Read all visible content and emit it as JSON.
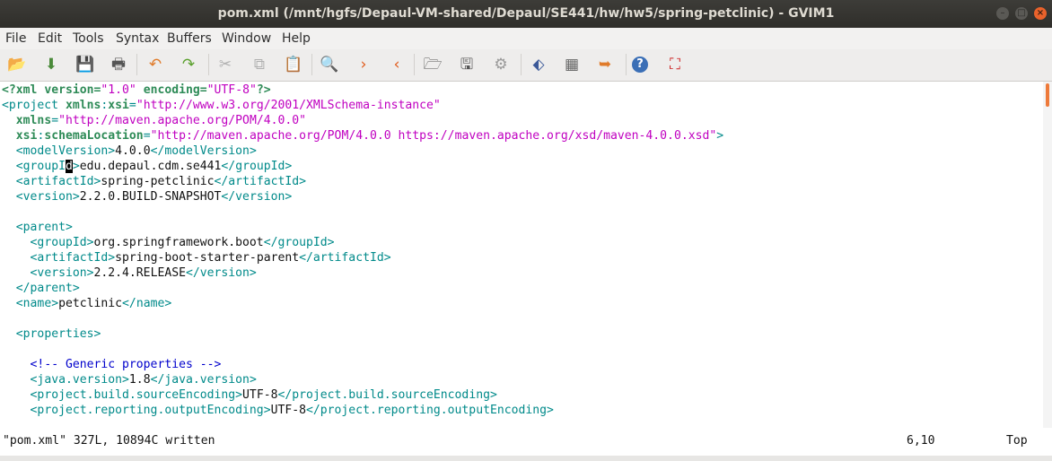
{
  "window": {
    "title": "pom.xml (/mnt/hgfs/Depaul-VM-shared/Depaul/SE441/hw/hw5/spring-petclinic) - GVIM1",
    "buttons": {
      "minimize": "–",
      "maximize": "□",
      "close": "×"
    }
  },
  "menu": [
    "File",
    "Edit",
    "Tools",
    "Syntax",
    "Buffers",
    "Window",
    "Help"
  ],
  "toolbar": [
    {
      "name": "open-icon",
      "glyph": "📂",
      "color": "#e07b2a"
    },
    {
      "name": "save-download-icon",
      "glyph": "⬇",
      "color": "#4a8a3a"
    },
    {
      "name": "save-icon",
      "glyph": "💾",
      "color": "#3b5998"
    },
    {
      "name": "print-icon",
      "glyph": "🖶",
      "color": "#555555"
    },
    {
      "name": "undo-icon",
      "glyph": "↶",
      "color": "#e07b2a"
    },
    {
      "name": "redo-icon",
      "glyph": "↷",
      "color": "#5aa02c"
    },
    {
      "name": "cut-icon",
      "glyph": "✂",
      "color": "#b0b0b0"
    },
    {
      "name": "copy-icon",
      "glyph": "⧉",
      "color": "#b0b0b0"
    },
    {
      "name": "paste-icon",
      "glyph": "📋",
      "color": "#7a6a4a"
    },
    {
      "name": "find-replace-icon",
      "glyph": "🔍",
      "color": "#3b5998"
    },
    {
      "name": "find-next-icon",
      "glyph": "›",
      "color": "#e05a1a"
    },
    {
      "name": "find-prev-icon",
      "glyph": "‹",
      "color": "#e05a1a"
    },
    {
      "name": "load-session-icon",
      "glyph": "🗁",
      "color": "#555555"
    },
    {
      "name": "save-session-icon",
      "glyph": "🖫",
      "color": "#555555"
    },
    {
      "name": "run-script-icon",
      "glyph": "⚙",
      "color": "#999999"
    },
    {
      "name": "make-icon",
      "glyph": "⬖",
      "color": "#3b5998"
    },
    {
      "name": "build-tags-icon",
      "glyph": "▦",
      "color": "#666666"
    },
    {
      "name": "jump-tag-icon",
      "glyph": "➥",
      "color": "#e07b2a"
    },
    {
      "name": "help-icon",
      "glyph": "?",
      "color": "#ffffff"
    },
    {
      "name": "find-help-icon",
      "glyph": "⛶",
      "color": "#cc2222"
    }
  ],
  "editor": {
    "lines": [
      [
        [
          "pi",
          "<?xml "
        ],
        [
          "pi",
          "version"
        ],
        [
          "pi",
          "="
        ],
        [
          "val",
          "\"1.0\""
        ],
        [
          "pi",
          " encoding"
        ],
        [
          "pi",
          "="
        ],
        [
          "val",
          "\"UTF-8\""
        ],
        [
          "pi",
          "?>"
        ]
      ],
      [
        [
          "tag",
          "<project "
        ],
        [
          "attr",
          "xmlns"
        ],
        [
          "tag",
          ":"
        ],
        [
          "attr",
          "xsi"
        ],
        [
          "tag",
          "="
        ],
        [
          "val",
          "\"http://www.w3.org/2001/XMLSchema-instance\""
        ]
      ],
      [
        [
          "plain",
          "  "
        ],
        [
          "attr",
          "xmlns"
        ],
        [
          "tag",
          "="
        ],
        [
          "val",
          "\"http://maven.apache.org/POM/4.0.0\""
        ]
      ],
      [
        [
          "plain",
          "  "
        ],
        [
          "attr",
          "xsi"
        ],
        [
          "tag",
          ":"
        ],
        [
          "attr",
          "schemaLocation"
        ],
        [
          "tag",
          "="
        ],
        [
          "val",
          "\"http://maven.apache.org/POM/4.0.0 https://maven.apache.org/xsd/maven-4.0.0.xsd\""
        ],
        [
          "tag",
          ">"
        ]
      ],
      [
        [
          "plain",
          "  "
        ],
        [
          "tag",
          "<modelVersion>"
        ],
        [
          "plain",
          "4.0.0"
        ],
        [
          "tag",
          "</modelVersion>"
        ]
      ],
      [
        [
          "plain",
          "  "
        ],
        [
          "tag",
          "<groupI"
        ],
        [
          "cursor",
          "d"
        ],
        [
          "tag",
          ">"
        ],
        [
          "plain",
          "edu.depaul.cdm.se441"
        ],
        [
          "tag",
          "</groupId>"
        ]
      ],
      [
        [
          "plain",
          "  "
        ],
        [
          "tag",
          "<artifactId>"
        ],
        [
          "plain",
          "spring-petclinic"
        ],
        [
          "tag",
          "</artifactId>"
        ]
      ],
      [
        [
          "plain",
          "  "
        ],
        [
          "tag",
          "<version>"
        ],
        [
          "plain",
          "2.2.0.BUILD-SNAPSHOT"
        ],
        [
          "tag",
          "</version>"
        ]
      ],
      [],
      [
        [
          "plain",
          "  "
        ],
        [
          "tag",
          "<parent>"
        ]
      ],
      [
        [
          "plain",
          "    "
        ],
        [
          "tag",
          "<groupId>"
        ],
        [
          "plain",
          "org.springframework.boot"
        ],
        [
          "tag",
          "</groupId>"
        ]
      ],
      [
        [
          "plain",
          "    "
        ],
        [
          "tag",
          "<artifactId>"
        ],
        [
          "plain",
          "spring-boot-starter-parent"
        ],
        [
          "tag",
          "</artifactId>"
        ]
      ],
      [
        [
          "plain",
          "    "
        ],
        [
          "tag",
          "<version>"
        ],
        [
          "plain",
          "2.2.4.RELEASE"
        ],
        [
          "tag",
          "</version>"
        ]
      ],
      [
        [
          "plain",
          "  "
        ],
        [
          "tag",
          "</parent>"
        ]
      ],
      [
        [
          "plain",
          "  "
        ],
        [
          "tag",
          "<name>"
        ],
        [
          "plain",
          "petclinic"
        ],
        [
          "tag",
          "</name>"
        ]
      ],
      [],
      [
        [
          "plain",
          "  "
        ],
        [
          "tag",
          "<properties>"
        ]
      ],
      [],
      [
        [
          "plain",
          "    "
        ],
        [
          "cmt",
          "<!-- Generic properties -->"
        ]
      ],
      [
        [
          "plain",
          "    "
        ],
        [
          "tag",
          "<java.version>"
        ],
        [
          "plain",
          "1.8"
        ],
        [
          "tag",
          "</java.version>"
        ]
      ],
      [
        [
          "plain",
          "    "
        ],
        [
          "tag",
          "<project.build.sourceEncoding>"
        ],
        [
          "plain",
          "UTF-8"
        ],
        [
          "tag",
          "</project.build.sourceEncoding>"
        ]
      ],
      [
        [
          "plain",
          "    "
        ],
        [
          "tag",
          "<project.reporting.outputEncoding>"
        ],
        [
          "plain",
          "UTF-8"
        ],
        [
          "tag",
          "</project.reporting.outputEncoding>"
        ]
      ]
    ]
  },
  "status": {
    "message": "\"pom.xml\" 327L, 10894C written",
    "position": "6,10",
    "scroll": "Top"
  }
}
